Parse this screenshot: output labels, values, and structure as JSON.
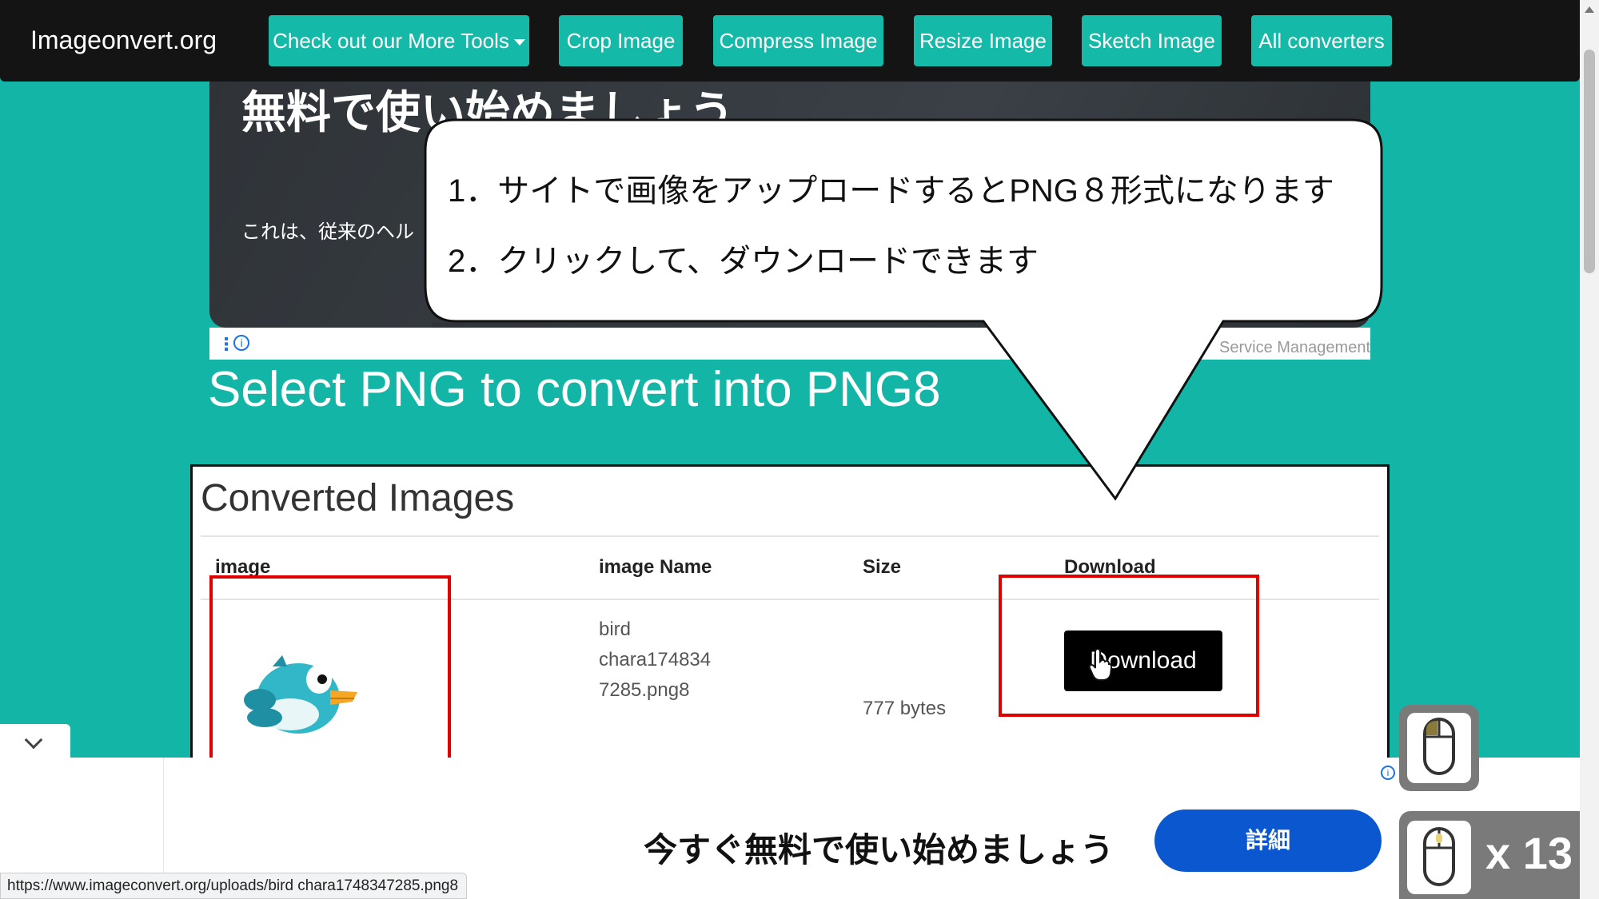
{
  "navbar": {
    "brand": "Imageonvert.org",
    "items": [
      {
        "label": "Check out our More Tools"
      },
      {
        "label": "Crop Image"
      },
      {
        "label": "Compress Image"
      },
      {
        "label": "Resize Image"
      },
      {
        "label": "Sketch Image"
      },
      {
        "label": "All converters"
      }
    ]
  },
  "ad": {
    "title": "無料で使い始めましょう",
    "text": "これは、従来のヘル",
    "service": "Service Management"
  },
  "callout": {
    "line1": "1．サイトで画像をアップロードするとPNG８形式になります",
    "line2": "2．クリックして、ダウンロードできます"
  },
  "page": {
    "heading": "Select PNG to convert into PNG8"
  },
  "converted": {
    "title": "Converted Images",
    "columns": [
      "image",
      "image Name",
      "Size",
      "Download"
    ],
    "row": {
      "name_lines": [
        "bird",
        "chara174834",
        "7285.png8"
      ],
      "size": "777 bytes",
      "download": "Download"
    }
  },
  "bottom_ad": {
    "title": "今すぐ無料で使い始めましょう",
    "button": "詳細"
  },
  "status_bar": {
    "url": "https://www.imageconvert.org/uploads/bird chara1748347285.png8"
  },
  "overlay": {
    "click_count": "x 13"
  },
  "colors": {
    "page_bg": "#13b5a6",
    "nav_bg": "#141414",
    "nav_button": "#15b9a8",
    "highlight": "#e00000",
    "details_button": "#0b57d0"
  }
}
